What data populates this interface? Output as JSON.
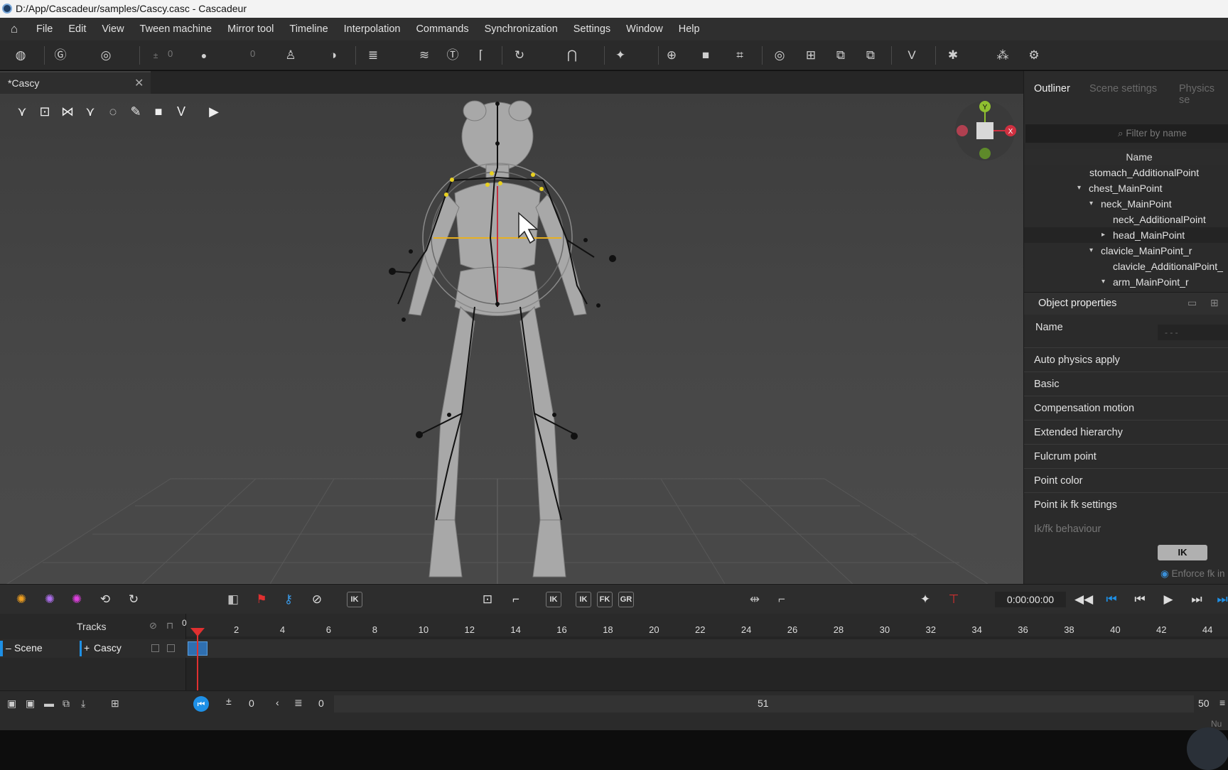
{
  "window": {
    "title": "D:/App/Cascadeur/samples/Cascy.casc - Cascadeur"
  },
  "menu": [
    "File",
    "Edit",
    "View",
    "Tween machine",
    "Mirror tool",
    "Timeline",
    "Interpolation",
    "Commands",
    "Synchronization",
    "Settings",
    "Window",
    "Help"
  ],
  "toolbar": {
    "field_a": "0",
    "field_b": "0"
  },
  "document_tab": {
    "label": "*Cascy"
  },
  "gizmo": {
    "y": "Y",
    "x": "X"
  },
  "right_panel": {
    "tabs": [
      "Outliner",
      "Scene settings",
      "Physics se"
    ],
    "filter_placeholder": "Filter by name",
    "name_header": "Name",
    "tree": [
      {
        "label": "stomach_AdditionalPoint",
        "expander": ""
      },
      {
        "label": "chest_MainPoint",
        "expander": "▾"
      },
      {
        "label": "neck_MainPoint",
        "expander": "▾"
      },
      {
        "label": "neck_AdditionalPoint",
        "expander": ""
      },
      {
        "label": "head_MainPoint",
        "expander": "▸"
      },
      {
        "label": "clavicle_MainPoint_r",
        "expander": "▾"
      },
      {
        "label": "clavicle_AdditionalPoint_",
        "expander": ""
      },
      {
        "label": "arm_MainPoint_r",
        "expander": "▾"
      }
    ],
    "object_properties": {
      "title": "Object properties",
      "name_label": "Name",
      "name_value": "- - -",
      "sections": [
        "Auto physics apply",
        "Basic",
        "Compensation motion",
        "Extended hierarchy",
        "Fulcrum point",
        "Point color",
        "Point ik fk settings"
      ],
      "ikfk_label": "Ik/fk behaviour",
      "ik_button": "IK",
      "enforce_label": "Enforce fk in"
    }
  },
  "timeline_toolbar": {
    "ik": "IK",
    "fk": "FK",
    "gr": "GR",
    "timecode": "0:00:00:00"
  },
  "tracks": {
    "header": "Tracks",
    "scene_label": "Scene",
    "cascy_label": "Cascy",
    "playhead_frame": "0",
    "ruler": [
      "2",
      "4",
      "6",
      "8",
      "10",
      "12",
      "14",
      "16",
      "18",
      "20",
      "22",
      "24",
      "26",
      "28",
      "30",
      "32",
      "34",
      "36",
      "38",
      "40",
      "42",
      "44"
    ]
  },
  "bottom_bar": {
    "start": "0",
    "frame": "0",
    "middle": "51",
    "end": "50",
    "status": "Nu"
  },
  "colors": {
    "accent": "#1e90e6",
    "playhead": "#e03030",
    "selection_yellow": "#e8d020"
  }
}
